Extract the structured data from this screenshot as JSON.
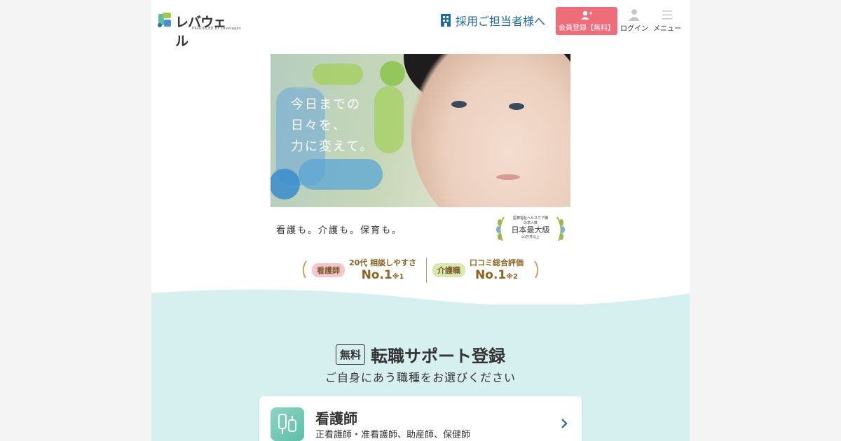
{
  "header": {
    "logo_text": "レバウェル",
    "logo_sub": "PRODUCED BY Leverages",
    "recruiter_link": "採用ご担当者様へ",
    "register_label": "会員登録【無料】",
    "login_label": "ログイン",
    "menu_label": "メニュー",
    "icons": [
      "building-icon",
      "user-plus-icon",
      "user-icon",
      "hamburger-icon"
    ]
  },
  "hero": {
    "copy_lines": [
      "今日までの",
      "日々を、",
      "力に変えて。"
    ]
  },
  "tagline": "看護も。介護も。保育も。",
  "award": {
    "line1": "医療福祉ヘルスケア職",
    "line2": "の求人数",
    "line3": "日本最大級",
    "line4": "20万件以上"
  },
  "rankings": [
    {
      "badge": "看護師",
      "badge_color": "#f5c7cc",
      "label": "20代 相談しやすさ",
      "rank": "No.1",
      "note": "※1"
    },
    {
      "badge": "介護職",
      "badge_color": "#d8e8b0",
      "label": "口コミ総合評価",
      "rank": "No.1",
      "note": "※2"
    }
  ],
  "registration": {
    "free_tag": "無料",
    "title": "転職サポート登録",
    "subtitle": "ご自身にあう職種をお選びください",
    "cards": [
      {
        "title": "看護師",
        "sub": "正看護師・准看護師、助産師、保健師"
      }
    ]
  },
  "colors": {
    "accent_blue": "#1b6aa5",
    "register_pink": "#ef6d7b",
    "section_bg": "#d6efef",
    "gold": "#8a6420"
  }
}
